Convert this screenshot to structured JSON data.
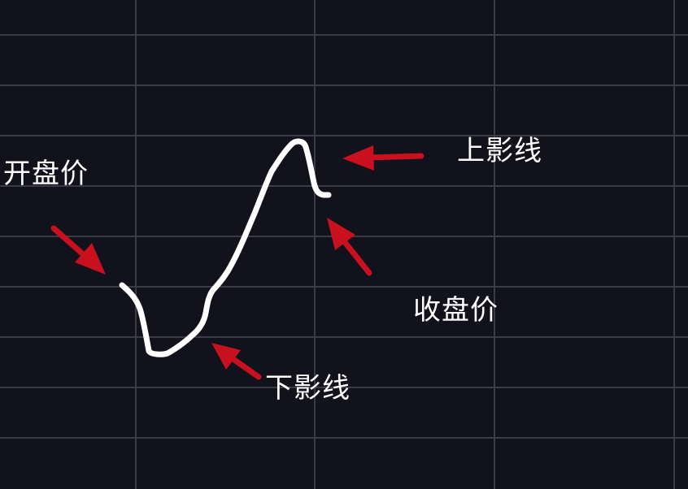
{
  "colors": {
    "background": "#11121c",
    "grid": "#3a3b47",
    "price_line": "#ffffff",
    "arrow": "#c8101e",
    "label_text": "#ffffff"
  },
  "labels": {
    "open_price": "开盘价",
    "upper_shadow": "上影线",
    "close_price": "收盘价",
    "lower_shadow": "下影线"
  }
}
